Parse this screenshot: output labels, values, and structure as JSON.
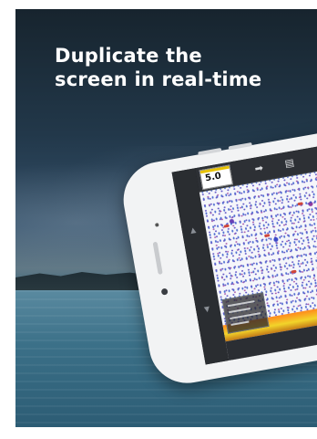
{
  "promo": {
    "headline_line1": "Duplicate the",
    "headline_line2": "screen in real-time"
  },
  "device_screen": {
    "range_value": "5.0",
    "toolbar_icons": [
      "display-icon",
      "menu-icon"
    ],
    "bottom_buttons": [
      "minus-icon",
      "plus-icon"
    ]
  },
  "colors": {
    "headline_text": "#ffffff",
    "sonar_bottom": "#f2d42a",
    "sonar_targets": "#4b3cbf"
  }
}
